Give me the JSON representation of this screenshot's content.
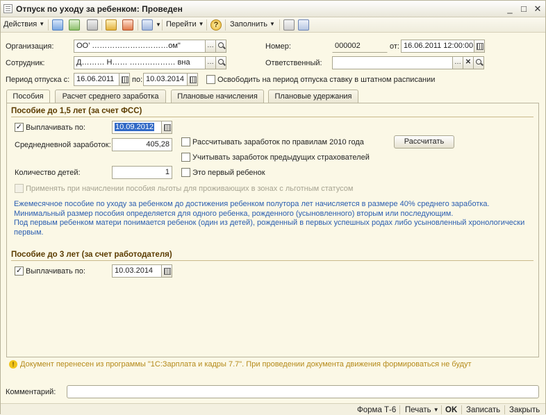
{
  "window": {
    "title": "Отпуск по уходу за ребенком: Проведен",
    "minimize": "_",
    "maximize": "□",
    "close": "✕"
  },
  "toolbar": {
    "actions_label": "Действия",
    "goto_label": "Перейти",
    "fill_label": "Заполнить",
    "help_label": "?"
  },
  "header": {
    "org_label": "Организация:",
    "org_value": "ОО’ …………………………ом\"",
    "employee_label": "Сотрудник:",
    "employee_value": "Д……… Н…… ……………… вна",
    "number_label": "Номер:",
    "number_value": "000002",
    "from_label": "от:",
    "from_value": "16.06.2011 12:00:00",
    "responsible_label": "Ответственный:",
    "responsible_value": "",
    "period_label": "Период отпуска с:",
    "period_from": "16.06.2011",
    "period_to_label": "по:",
    "period_to": "10.03.2014",
    "release_rate_label": "Освободить на период отпуска ставку в штатном расписании"
  },
  "tabs": [
    {
      "label": "Пособия"
    },
    {
      "label": "Расчет среднего заработка"
    },
    {
      "label": "Плановые начисления"
    },
    {
      "label": "Плановые удержания"
    }
  ],
  "section15": {
    "title": "Пособие до 1,5 лет (за счет ФСС)",
    "pay_until_label": "Выплачивать по:",
    "pay_until_value": "10.09.2012",
    "avg_earnings_label": "Среднедневной заработок:",
    "avg_earnings_value": "405,28",
    "rules2010_label": "Рассчитывать заработок по правилам 2010 года",
    "prev_insurers_label": "Учитывать заработок предыдущих страхователей",
    "calc_button": "Рассчитать",
    "children_label": "Количество детей:",
    "children_value": "1",
    "first_child_label": "Это первый ребенок",
    "privilege_label": "Применять при начислении пособия льготы для проживающих в зонах с льготным статусом",
    "info_lines": [
      "Ежемесячное пособие по уходу за ребенком до достижения ребенком полутора лет начисляется в размере 40% среднего заработка.",
      "Минимальный размер пособия определяется для одного ребенка, рожденного (усыновленного) вторым или последующим.",
      "Под первым ребенком матери понимается ребенок (один из детей), рожденный в первых успешных родах либо усыновленный хронологически",
      "первым."
    ]
  },
  "section3": {
    "title": "Пособие до 3 лет (за счет работодателя)",
    "pay_until_label": "Выплачивать по:",
    "pay_until_value": "10.03.2014"
  },
  "note": "Документ перенесен из программы \"1С:Зарплата и кадры 7.7\". При проведении документа движения формироваться не будут",
  "comment_label": "Комментарий:",
  "comment_value": "",
  "footer": {
    "form_t6": "Форма Т-6",
    "print": "Печать",
    "ok": "OK",
    "save": "Записать",
    "close": "Закрыть"
  }
}
